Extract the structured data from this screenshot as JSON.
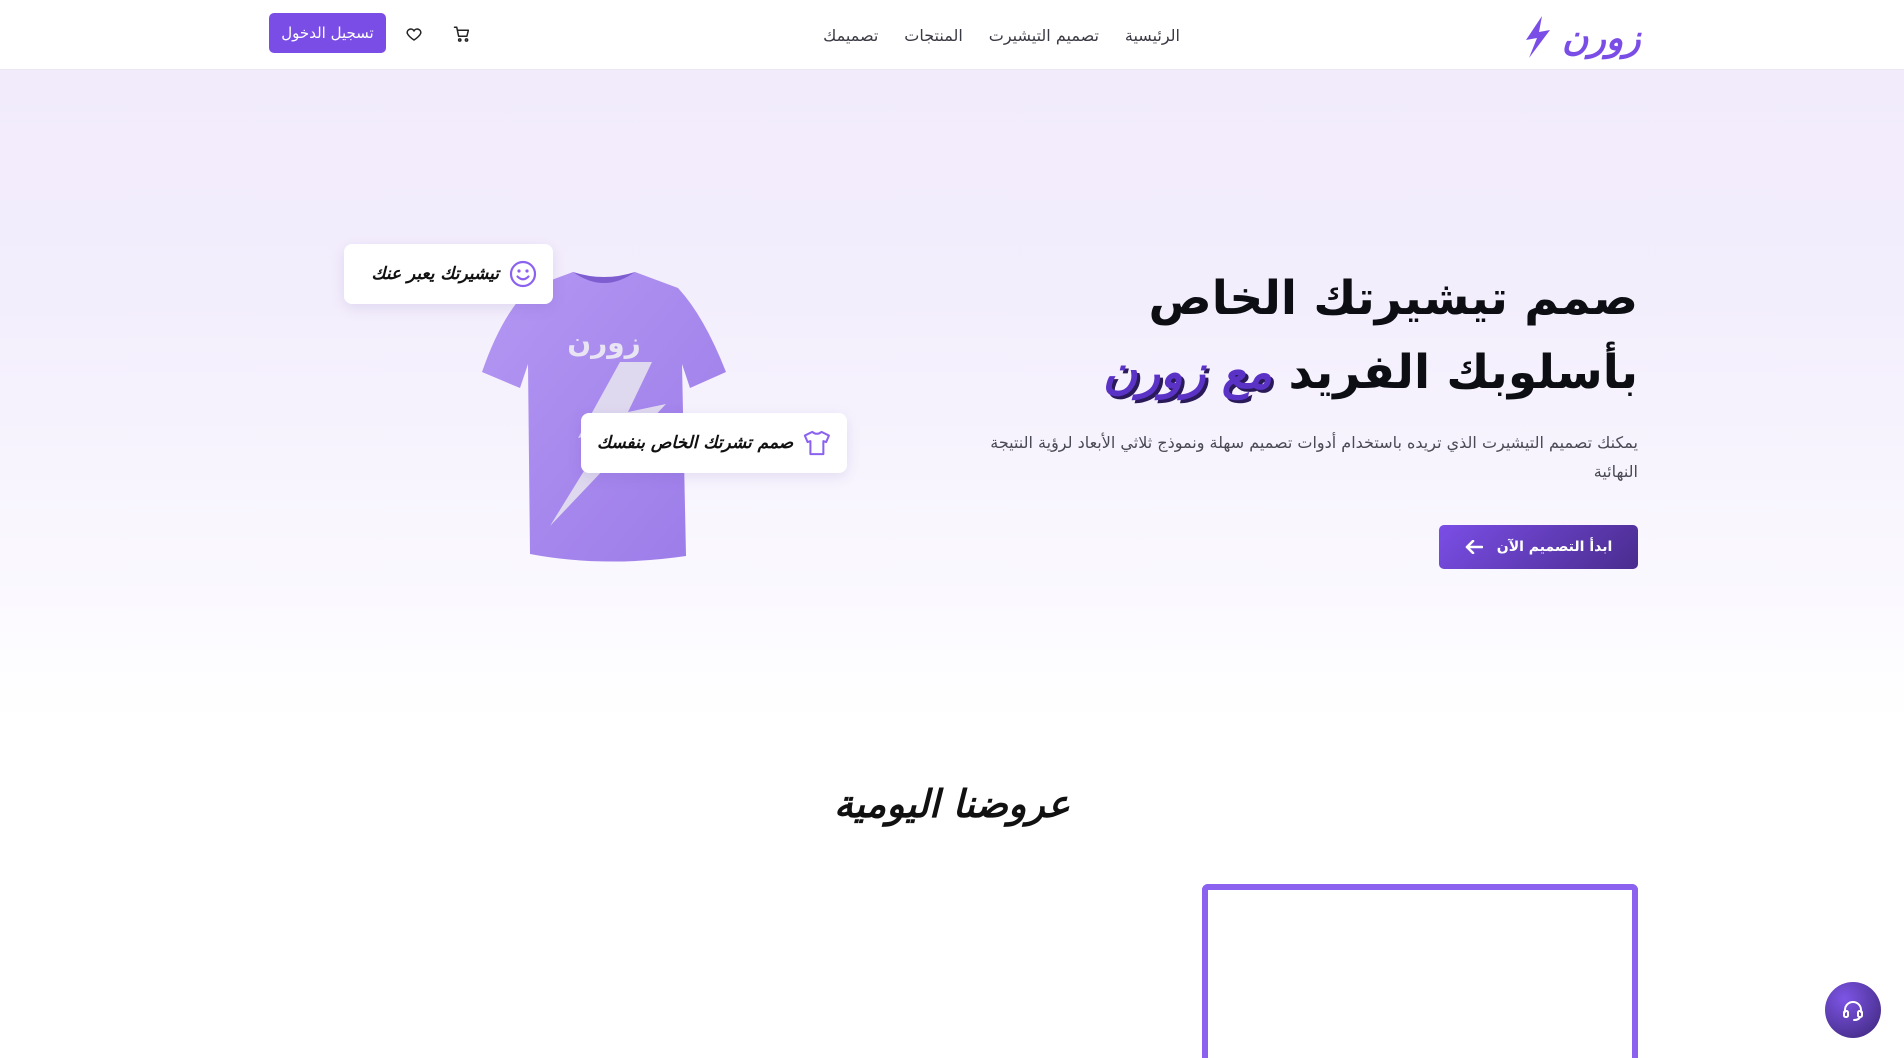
{
  "header": {
    "logo_text": "زورن",
    "nav": [
      {
        "label": "الرئيسية"
      },
      {
        "label": "تصميم التيشيرت"
      },
      {
        "label": "المنتجات"
      },
      {
        "label": "تصميمك"
      }
    ],
    "login_label": "تسجيل الدخول",
    "icons": [
      "heart-icon",
      "cart-icon"
    ]
  },
  "hero": {
    "title_main": "صمم تيشيرتك الخاص بأسلوبك الفريد",
    "title_accent": "مع زورن",
    "description": "يمكنك تصميم التيشيرت الذي تريده باستخدام أدوات تصميم سهلة ونموذج ثلاثي الأبعاد لرؤية النتيجة النهائية",
    "cta_label": "ابدأ التصميم الآن",
    "tshirt_print": "زورن",
    "float_cards": [
      {
        "label": "تيشيرتك يعبر عنك",
        "icon": "smile-icon"
      },
      {
        "label": "صمم تشرتك الخاص بنفسك",
        "icon": "tshirt-icon"
      }
    ]
  },
  "offers": {
    "title": "عروضنا اليومية"
  },
  "colors": {
    "accent": "#7a4ee6",
    "accent_dark": "#4a2c8e",
    "tshirt": "#a98af0",
    "frame": "#8b62f0"
  }
}
